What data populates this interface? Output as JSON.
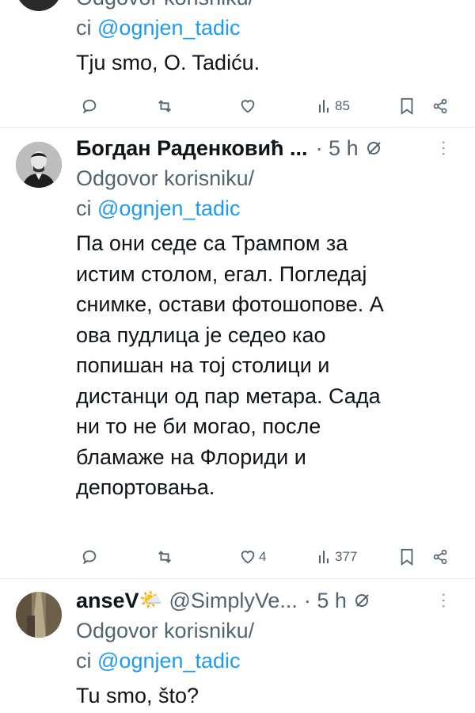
{
  "tweets": [
    {
      "reply_prefix": "Odgovor korisniku/",
      "reply_prefix2": "ci",
      "reply_handle": "@ognjen_tadic",
      "text_lines": [
        "Tju smo, O. Tadiću."
      ],
      "stats": {
        "replies": "",
        "reposts": "",
        "likes": "",
        "views": "85"
      }
    },
    {
      "name": "Богдан Раденковић ...",
      "time": "· 5 h",
      "reply_prefix": "Odgovor korisniku/",
      "reply_prefix2": "ci",
      "reply_handle": "@ognjen_tadic",
      "text_lines": [
        "Па они седе са Трампом за",
        "истим столом, егал. Погледај",
        "снимке, остави фотошопове. А",
        "ова пудлица је седео као",
        "попишан на тој столици и",
        "дистанци од пар метара. Сада",
        "ни то не би могао, после",
        "бламаже на Флориди и",
        "депортовања."
      ],
      "stats": {
        "replies": "",
        "reposts": "",
        "likes": "4",
        "views": "377"
      }
    },
    {
      "name": "anseV",
      "emoji": "🌤️",
      "handle": "@SimplyVe...",
      "time": "· 5 h",
      "reply_prefix": "Odgovor korisniku/",
      "reply_prefix2": "ci",
      "reply_handle": "@ognjen_tadic",
      "text_lines": [
        "Tu smo, što?"
      ]
    }
  ],
  "top_partial": "Odgovor korisniku/",
  "icons": {
    "reply": "reply-icon",
    "repost": "repost-icon",
    "like": "heart-icon",
    "views": "views-icon",
    "bookmark": "bookmark-icon",
    "share": "share-icon",
    "grok": "grok-icon",
    "more": "more-icon"
  },
  "colors": {
    "link": "#1d9bf0",
    "secondary": "#536471",
    "divider": "#e6e9ec"
  }
}
